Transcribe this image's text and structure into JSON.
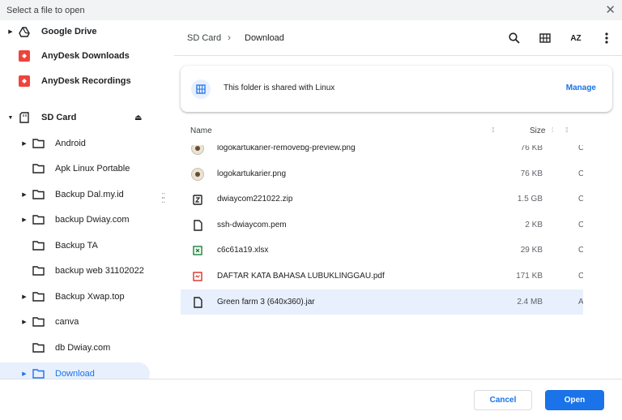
{
  "titlebar": {
    "title": "Select a file to open",
    "close_glyph": "✕"
  },
  "sidebar": {
    "items": [
      {
        "label": "Google Drive",
        "icon": "google-drive-icon"
      },
      {
        "label": "AnyDesk Downloads",
        "icon": "anydesk-icon"
      },
      {
        "label": "AnyDesk Recordings",
        "icon": "anydesk-icon"
      },
      {
        "label": "SD Card",
        "icon": "sd-card-icon"
      },
      {
        "label": "Android",
        "icon": "folder-icon"
      },
      {
        "label": "Apk Linux Portable",
        "icon": "folder-icon"
      },
      {
        "label": "Backup Dal.my.id",
        "icon": "folder-icon"
      },
      {
        "label": "backup Dwiay.com",
        "icon": "folder-icon"
      },
      {
        "label": "Backup TA",
        "icon": "folder-icon"
      },
      {
        "label": "backup web 31102022",
        "icon": "folder-icon"
      },
      {
        "label": "Backup Xwap.top",
        "icon": "folder-icon"
      },
      {
        "label": "canva",
        "icon": "folder-icon"
      },
      {
        "label": "db Dwiay.com",
        "icon": "folder-icon"
      },
      {
        "label": "Download",
        "icon": "folder-icon"
      }
    ]
  },
  "breadcrumb": {
    "root": "SD Card",
    "current": "Download",
    "separator": "›"
  },
  "toolbar": {
    "sort_label": "AZ"
  },
  "banner": {
    "text": "This folder is shared with Linux",
    "action": "Manage"
  },
  "columns": {
    "name": "Name",
    "size": "Size"
  },
  "files": [
    {
      "name": "logokartukarier-removebg-preview.png",
      "size": "76 KB",
      "type": "C",
      "icon": "image-thumbnail-icon"
    },
    {
      "name": "logokartukarier.png",
      "size": "76 KB",
      "type": "C",
      "icon": "image-thumbnail-icon"
    },
    {
      "name": "dwiaycom221022.zip",
      "size": "1.5 GB",
      "type": "C",
      "icon": "archive-icon"
    },
    {
      "name": "ssh-dwiaycom.pem",
      "size": "2 KB",
      "type": "C",
      "icon": "file-icon"
    },
    {
      "name": "c6c61a19.xlsx",
      "size": "29 KB",
      "type": "C",
      "icon": "spreadsheet-icon"
    },
    {
      "name": "DAFTAR KATA BAHASA LUBUKLINGGAU.pdf",
      "size": "171 KB",
      "type": "C",
      "icon": "pdf-icon"
    },
    {
      "name": "Green farm 3 (640x360).jar",
      "size": "2.4 MB",
      "type": "A",
      "icon": "file-icon"
    }
  ],
  "footer": {
    "cancel": "Cancel",
    "open": "Open"
  },
  "colors": {
    "accent": "#1a73e8",
    "selected_bg": "#e8f0fe",
    "anydesk": "#ef443b",
    "xlsx": "#188038",
    "pdf": "#d93025"
  }
}
